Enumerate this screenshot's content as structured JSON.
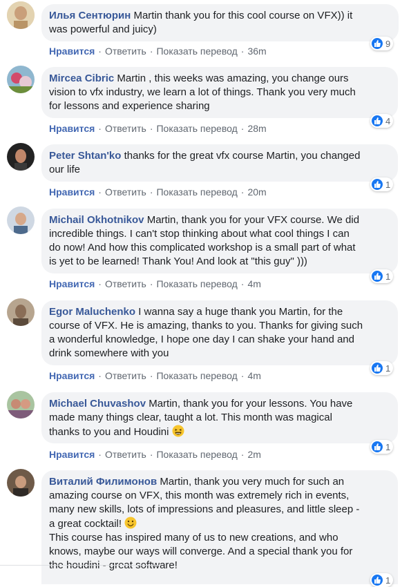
{
  "colors": {
    "link": "#385898",
    "like": "#4267b2",
    "meta": "#606770",
    "bubble": "#f2f3f5",
    "reaction": "#1877f2"
  },
  "actions": {
    "like": "Нравится",
    "reply": "Ответить",
    "translate": "Показать перевод",
    "sep": "·"
  },
  "comments": [
    {
      "author": "Илья Сентюрин",
      "text": "Martin thank you for this cool course on VFX)) it\nwas powerful and juicy)",
      "time": "36m",
      "reactions": "9",
      "reaction_icon": "like-icon"
    },
    {
      "author": "Mircea Cibric",
      "text": "Martin , this weeks was amazing, you change ours\nvision to vfx industry, we learn a lot of things. Thank you very much\nfor lessons and experience sharing",
      "time": "28m",
      "reactions": "4",
      "reaction_icon": "like-icon"
    },
    {
      "author": "Peter Shtan'ko",
      "text": "thanks for the great vfx course Martin, you changed\nour life",
      "time": "20m",
      "reactions": "1",
      "reaction_icon": "like-icon"
    },
    {
      "author": "Michail Okhotnikov",
      "text": "Martin, thank you for your VFX course. We did\nincredible things. I can't stop thinking about what cool things I can\ndo now! And how this complicated workshop is a small part of what\nis yet to be learned! Thank You! And look at \"this guy\" )))",
      "time": "4m",
      "reactions": "1",
      "reaction_icon": "like-icon"
    },
    {
      "author": "Egor Maluchenko",
      "text": "I wanna say a huge thank you Martin, for the\ncourse of VFX. He is amazing, thanks to you. Thanks for giving such\na wonderful knowledge, I hope one day I can shake your hand and\ndrink somewhere with you",
      "time": "4m",
      "reactions": "1",
      "reaction_icon": "like-icon"
    },
    {
      "author": "Michael Chuvashov",
      "text": "Martin, thank you for your lessons. You have\nmade many things clear, taught a lot. This month was magical\nthanks to you and Houdini",
      "time": "2m",
      "reactions": "1",
      "reaction_icon": "like-icon",
      "emoji": "laughing-emoji-icon"
    },
    {
      "author": "Виталий Филимонов",
      "text": "Martin, thank you very much for such an\namazing course on VFX, this month was extremely rich in events,\nmany new skills, lots of impressions and pleasures, and little sleep -\na great cocktail!",
      "text2": "This course has inspired many of us to new creations, and who\nknows, maybe our ways will converge. And a special thank you for\nthe houdini - great software!",
      "reactions": "1",
      "reaction_icon": "like-icon",
      "emoji": "smile-emoji-icon"
    }
  ]
}
